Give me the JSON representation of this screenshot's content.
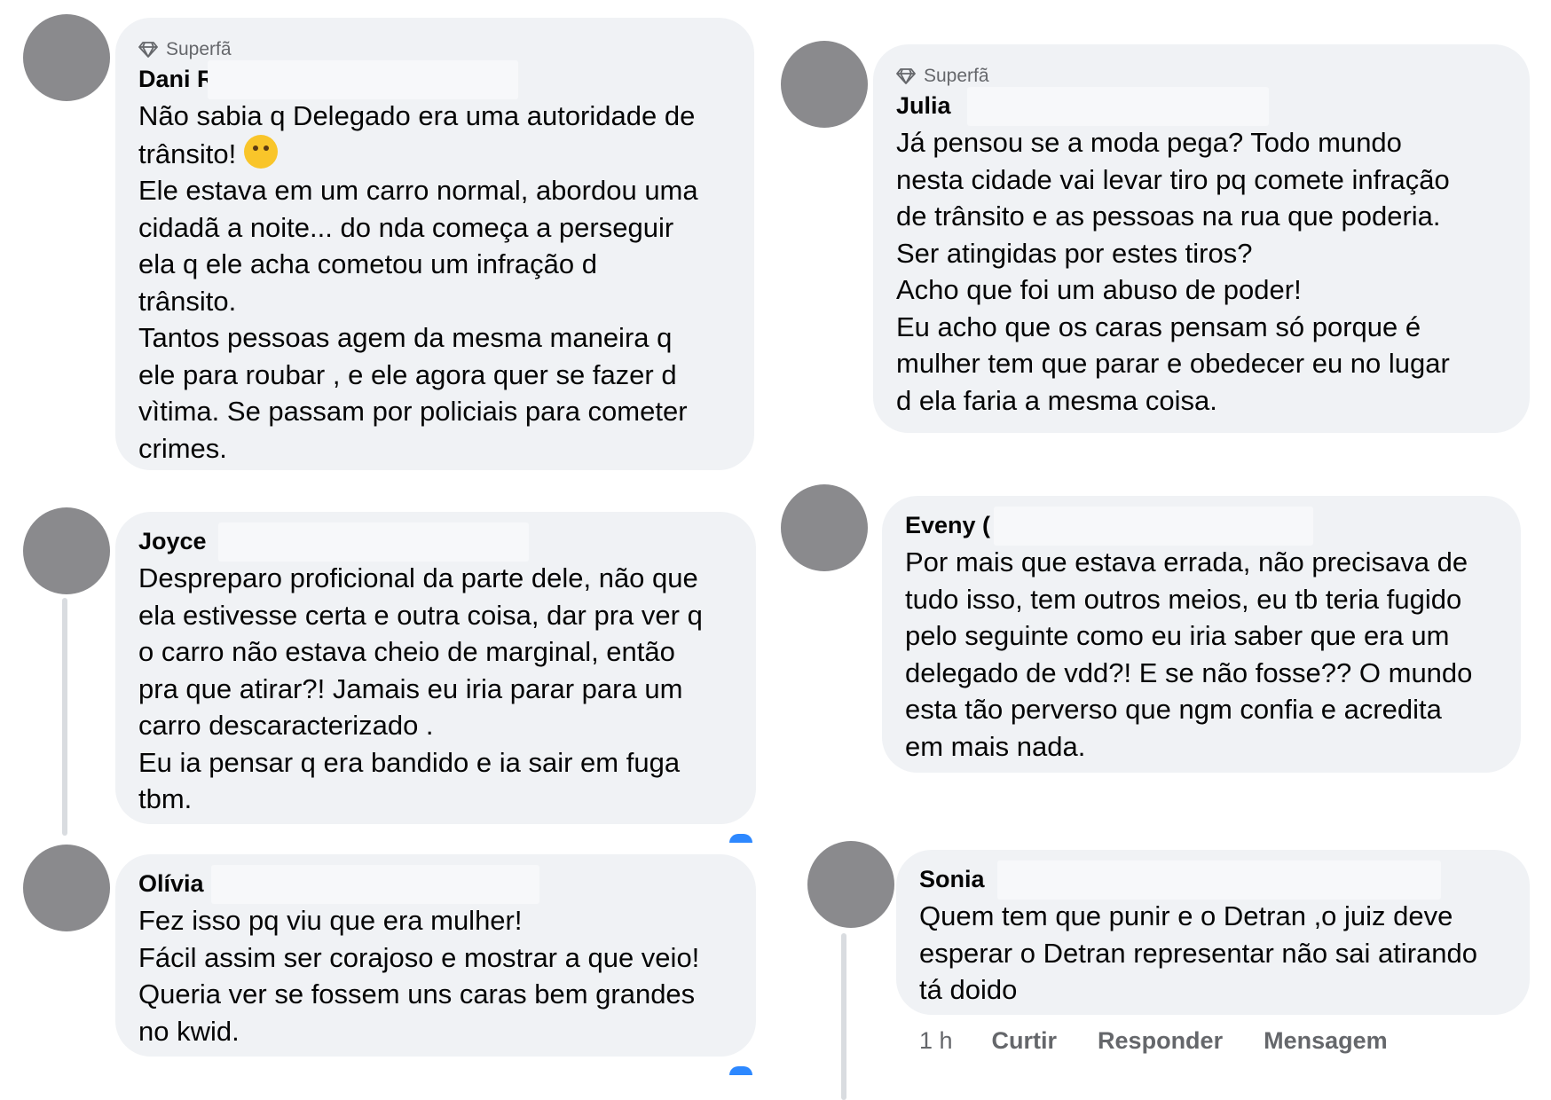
{
  "comments": [
    {
      "badge": "Superfã",
      "author": "Dani R",
      "text": "Não sabia q Delegado  era uma autoridade de trânsito!",
      "emoji": "thinking-face",
      "text2": "Ele estava em um carro normal,  abordou uma\ncidadã a noite...   do nda começa  a perseguir\nela q ele acha cometou um infração d\ntrânsito.\nTantos pessoas agem da mesma maneira q\nele para roubar , e ele agora quer se fazer d\nvìtima.  Se passam por policiais para cometer\ncrimes."
    },
    {
      "badge": "Superfã",
      "author": "Julia",
      "text": "Já pensou se a moda pega? Todo mundo\nnesta cidade vai levar tiro pq comete infração\nde trânsito e as pessoas na rua que poderia.\nSer atingidas por estes tiros?\nAcho que foi um abuso de poder!\nEu acho que os caras pensam só porque é\nmulher tem que parar e obedecer eu no lugar\nd ela faria a mesma coisa."
    },
    {
      "author": "Joyce",
      "text": "Despreparo proficional da parte dele, não que\nela estivesse certa e outra coisa, dar pra ver q\no carro não estava cheio de marginal, então\npra que atirar?! Jamais eu iria parar para um\ncarro descaracterizado .\nEu ia pensar q era bandido e ia sair em fuga\ntbm."
    },
    {
      "author": "Eveny (",
      "text": "Por mais que estava errada, não precisava de\ntudo isso, tem outros meios, eu tb teria fugido\npelo seguinte como eu iria saber que era um\ndelegado de vdd?! E se não fosse?? O mundo\nesta tão perverso que ngm confia e acredita\nem mais nada."
    },
    {
      "author": "Olívia",
      "text": "Fez isso pq viu que era mulher!\nFácil assim ser corajoso e mostrar a que veio!\nQueria ver se fossem uns caras bem grandes\nno kwid."
    },
    {
      "author": "Sonia",
      "text": "Quem tem que punir e o Detran ,o juiz deve\nesperar  o Detran representar não sai atirando\ntá doido"
    }
  ],
  "actions": {
    "time": "1 h",
    "like": "Curtir",
    "reply": "Responder",
    "message": "Mensagem"
  },
  "colors": {
    "bubble": "#f0f2f5",
    "avatar": "#8a8a8d",
    "meta_text": "#65676b"
  }
}
